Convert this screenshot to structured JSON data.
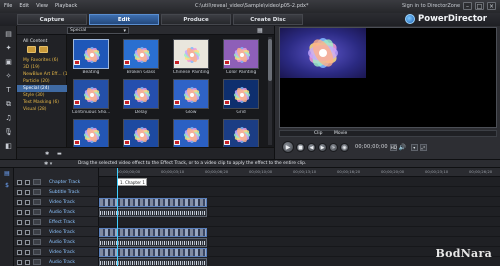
{
  "titlebar": {
    "menu": [
      "File",
      "Edit",
      "View",
      "Playback"
    ],
    "path": "C:\\util\\reveal_video\\Sample\\video\\p05-2.pdx*",
    "directorzone": "Sign in to DirectorZone"
  },
  "tabs": [
    {
      "label": "Capture"
    },
    {
      "label": "Edit",
      "active": true
    },
    {
      "label": "Produce"
    },
    {
      "label": "Create Disc"
    }
  ],
  "brand": {
    "name": "PowerDirector"
  },
  "library": {
    "filter": "Special"
  },
  "categories": {
    "header": "All Content",
    "items": [
      {
        "label": "My Favorites  (6)"
      },
      {
        "label": "3D  (19)"
      },
      {
        "label": "NewBlue Art Eff... (13)"
      },
      {
        "label": "Particle  (20)"
      },
      {
        "label": "Special  (24)",
        "active": true
      },
      {
        "label": "Style  (30)"
      },
      {
        "label": "Text Masking  (6)"
      },
      {
        "label": "Visual  (28)"
      }
    ]
  },
  "effects": [
    {
      "label": "Beating",
      "color": "#1f57b8"
    },
    {
      "label": "Broken Glass",
      "color": "#2a6fd0"
    },
    {
      "label": "Chinese Painting",
      "color": "#e9e6dd"
    },
    {
      "label": "Color Painting",
      "color": "#8e5fb8"
    },
    {
      "label": "Continuous Sho...",
      "color": "#2450a8"
    },
    {
      "label": "Delay",
      "color": "#254fae"
    },
    {
      "label": "Glow",
      "color": "#2f63c7"
    },
    {
      "label": "Grid",
      "color": "#0e2f6e"
    },
    {
      "label": "",
      "color": "#2356b4"
    },
    {
      "label": "",
      "color": "#1d4aa1"
    },
    {
      "label": "",
      "color": "#2b60c3"
    },
    {
      "label": "",
      "color": "#1b3d84"
    }
  ],
  "tip": {
    "text": "Drag the selected video effect to the Effect Track, or to a video clip to apply the effect to the entire clip."
  },
  "preview": {
    "clip_label": "Clip",
    "movie_label": "Movie",
    "timecode": "00;00;00;00",
    "quality": "HD"
  },
  "tracks": [
    {
      "name": "Chapter Track",
      "kind": "chapter"
    },
    {
      "name": "Subtitle Track",
      "kind": "subtitle"
    },
    {
      "name": "Video Track",
      "kind": "video"
    },
    {
      "name": "Audio Track",
      "kind": "audio"
    },
    {
      "name": "Effect Track",
      "kind": "effect"
    },
    {
      "name": "Video Track",
      "kind": "video"
    },
    {
      "name": "Audio Track",
      "kind": "audio"
    },
    {
      "name": "Video Track",
      "kind": "video"
    },
    {
      "name": "Audio Track",
      "kind": "audio"
    }
  ],
  "chapter_marker": "1. Chapter 1",
  "ruler": [
    "00;00;00;00",
    "00;00;03;10",
    "00;00;06;20",
    "00;00;10;00",
    "00;00;13;10",
    "00;00;16;20",
    "00;00;20;00",
    "00;00;23;10",
    "00;00;26;20"
  ],
  "watermark": "BodNara"
}
